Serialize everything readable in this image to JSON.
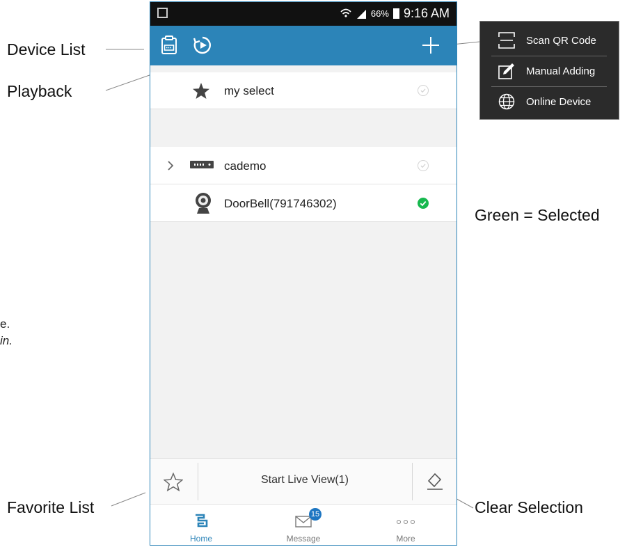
{
  "callouts": {
    "device_list": "Device List",
    "playback": "Playback",
    "green_selected": "Green = Selected",
    "favorite_list": "Favorite List",
    "clear_selection": "Clear Selection",
    "partial_line1": "e.",
    "partial_line2": "in."
  },
  "status_bar": {
    "battery": "66%",
    "time": "9:16 AM"
  },
  "device_rows": [
    {
      "label": "my select",
      "selected": false
    },
    {
      "label": "cademo",
      "selected": false
    },
    {
      "label": "DoorBell(791746302)",
      "selected": true
    }
  ],
  "bottom_action": {
    "live_label": "Start Live View(1)"
  },
  "tabs": [
    {
      "label": "Home",
      "active": true
    },
    {
      "label": "Message",
      "badge": "15"
    },
    {
      "label": "More"
    }
  ],
  "add_menu": [
    "Scan QR Code",
    "Manual Adding",
    "Online Device"
  ],
  "colors": {
    "header": "#2c84b8",
    "selected": "#16b84e",
    "badge": "#1d76c2"
  }
}
